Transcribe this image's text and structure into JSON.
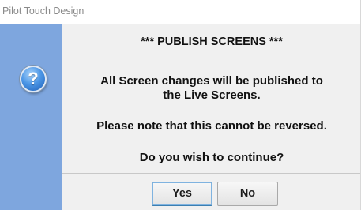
{
  "window": {
    "title": "Pilot Touch Design"
  },
  "icons": {
    "help": "question-mark-icon",
    "glyph": "?"
  },
  "message": {
    "title": "*** PUBLISH SCREENS ***",
    "line1": "All Screen changes will be published to",
    "line2": "the Live Screens.",
    "note": "Please note that this cannot be reversed.",
    "question": "Do you wish to continue?"
  },
  "buttons": {
    "yes_label": "Yes",
    "no_label": "No"
  },
  "colors": {
    "sidebar": "#7ea6de",
    "background": "#f0f0f0",
    "default_button_border": "#3c7fb1"
  }
}
